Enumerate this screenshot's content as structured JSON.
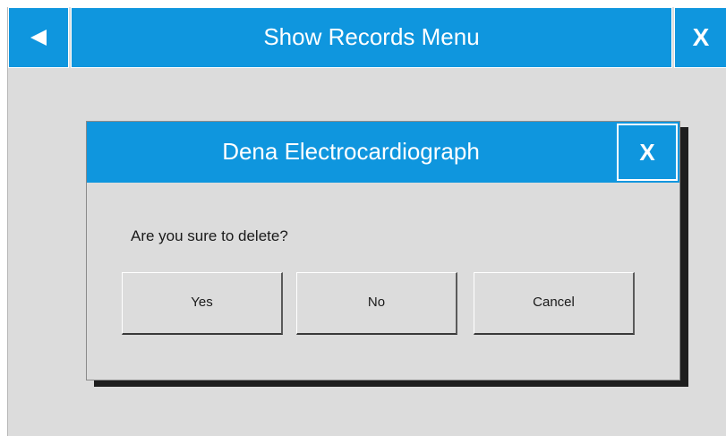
{
  "header": {
    "back_icon": "left-triangle-icon",
    "title": "Show Records Menu",
    "close_label": "X"
  },
  "dialog": {
    "title": "Dena Electrocardiograph",
    "close_label": "X",
    "message": "Are you sure to delete?",
    "buttons": {
      "yes": "Yes",
      "no": "No",
      "cancel": "Cancel"
    }
  },
  "colors": {
    "accent": "#0f96de",
    "background": "#dcdcdc"
  }
}
